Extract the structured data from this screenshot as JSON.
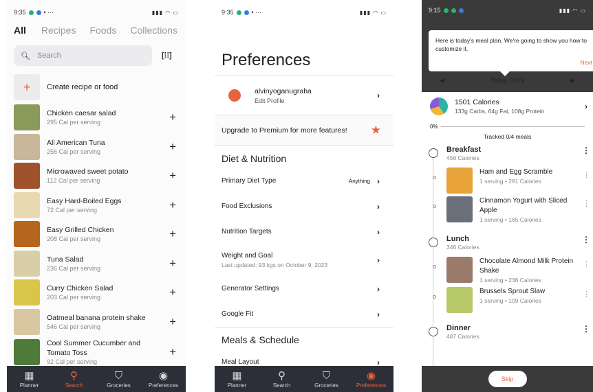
{
  "screens": {
    "search": {
      "status_time": "9:35",
      "tabs": [
        "All",
        "Recipes",
        "Foods",
        "Collections"
      ],
      "search_placeholder": "Search",
      "create_label": "Create recipe or food",
      "foods": [
        {
          "name": "Chicken caesar salad",
          "cal": "295 Cal per serving",
          "color": "#8a9a5b"
        },
        {
          "name": "All American Tuna",
          "cal": "256 Cal per serving",
          "color": "#c9b79a"
        },
        {
          "name": "Microwaved sweet potato",
          "cal": "112 Cal per serving",
          "color": "#a0522d"
        },
        {
          "name": "Easy Hard-Boiled Eggs",
          "cal": "72 Cal per serving",
          "color": "#e8d9b0"
        },
        {
          "name": "Easy Grilled Chicken",
          "cal": "208 Cal per serving",
          "color": "#b5651d"
        },
        {
          "name": "Tuna Salad",
          "cal": "236 Cal per serving",
          "color": "#d8cfa8"
        },
        {
          "name": "Curry Chicken Salad",
          "cal": "203 Cal per serving",
          "color": "#d9c54a"
        },
        {
          "name": "Oatmeal banana protein shake",
          "cal": "546 Cal per serving",
          "color": "#d8c7a0"
        },
        {
          "name": "Cool Summer Cucumber and Tomato Toss",
          "cal": "92 Cal per serving",
          "color": "#4e7a3a"
        }
      ]
    },
    "preferences": {
      "status_time": "9:35",
      "title": "Preferences",
      "profile_name": "alvinyoganugraha",
      "profile_sub": "Edit Profile",
      "premium": "Upgrade to Premium for more features!",
      "diet_section": "Diet & Nutrition",
      "primary_diet": "Primary Diet Type",
      "primary_diet_value": "Anything",
      "food_exclusions": "Food Exclusions",
      "nutrition_targets": "Nutrition Targets",
      "weight_goal": "Weight and Goal",
      "weight_sub": "Last updated: 93 kgs on October 9, 2023",
      "generator": "Generator Settings",
      "google_fit": "Google Fit",
      "meals_section": "Meals & Schedule",
      "meal_layout": "Meal Layout"
    },
    "planner": {
      "status_time": "9:15",
      "tooltip": "Here is today's meal plan. We're going to show you how to customize it.",
      "tooltip_next": "Next",
      "date": "Today, Oct 9",
      "calories": "1501 Calories",
      "macros": "133g Carbs, 64g Fat, 108g Protein",
      "progress": "0%",
      "tracked": "Tracked 0/4 meals",
      "meals": [
        {
          "title": "Breakfast",
          "cal": "456 Calories",
          "dishes": [
            {
              "name": "Ham and Egg Scramble",
              "sub": "1 serving • 291 Calories",
              "color": "#e8a33a"
            },
            {
              "name": "Cinnamon Yogurt with Sliced Apple",
              "sub": "1 serving • 165 Calories",
              "color": "#6b6f7a"
            }
          ]
        },
        {
          "title": "Lunch",
          "cal": "346 Calories",
          "dishes": [
            {
              "name": "Chocolate Almond Milk Protein Shake",
              "sub": "1 serving • 236 Calories",
              "color": "#9a7b6b"
            },
            {
              "name": "Brussels Sprout Slaw",
              "sub": "1 serving • 109 Calories",
              "color": "#b8c96a"
            }
          ]
        },
        {
          "title": "Dinner",
          "cal": "487 Calories",
          "dishes": []
        }
      ],
      "skip": "Skip"
    }
  },
  "nav": {
    "planner": "Planner",
    "search": "Search",
    "groceries": "Groceries",
    "preferences": "Preferences"
  },
  "colors": {
    "accent": "#e8643c",
    "nav_bg": "#2d2f38"
  }
}
